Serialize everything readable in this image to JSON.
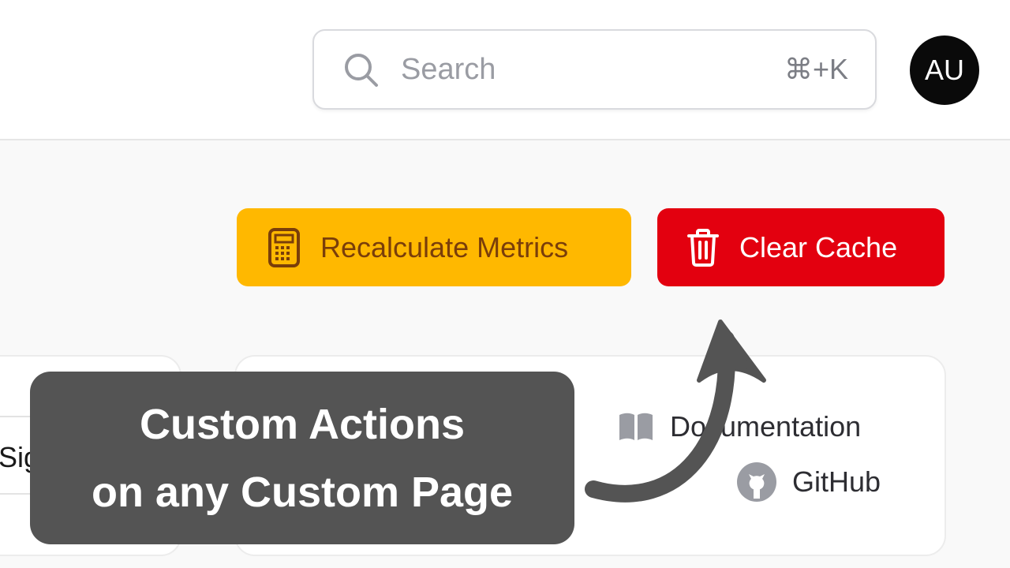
{
  "header": {
    "search": {
      "placeholder": "Search",
      "shortcut": "⌘+K",
      "icon": "search-icon"
    },
    "avatar": {
      "initials": "AU"
    }
  },
  "actions": [
    {
      "label": "Recalculate Metrics",
      "icon": "calculator-icon",
      "bg": "#ffb800",
      "fg": "#7a3e0a"
    },
    {
      "label": "Clear Cache",
      "icon": "trash-icon",
      "bg": "#e3000f",
      "fg": "#ffffff"
    }
  ],
  "left_card": {
    "partial_text": "Sig"
  },
  "links": [
    {
      "label": "Documentation",
      "icon": "book-icon"
    },
    {
      "label": "GitHub",
      "icon": "github-icon"
    }
  ],
  "caption": {
    "line1": "Custom Actions",
    "line2": "on any Custom Page",
    "bg": "#545454"
  }
}
